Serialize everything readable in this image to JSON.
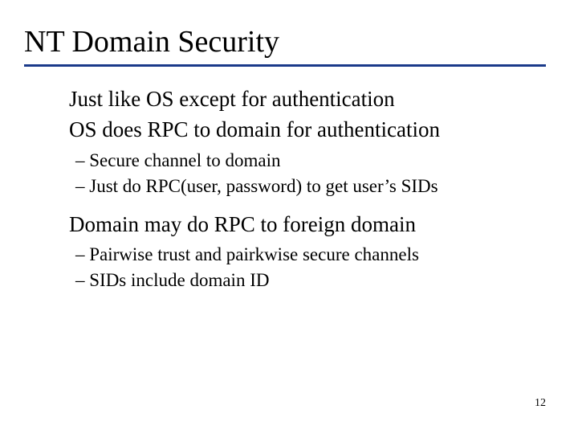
{
  "title": "NT Domain Security",
  "body": {
    "p1": "Just like OS except for authentication",
    "p2": "OS does RPC to domain for authentication",
    "p2_subs": {
      "s1": "Secure channel to domain",
      "s2": "Just do RPC(user, password) to get user’s SIDs"
    },
    "p3": "Domain may do RPC to foreign domain",
    "p3_subs": {
      "s1": "Pairwise trust and pairkwise secure channels",
      "s2": "SIDs include domain ID"
    }
  },
  "page_number": "12"
}
